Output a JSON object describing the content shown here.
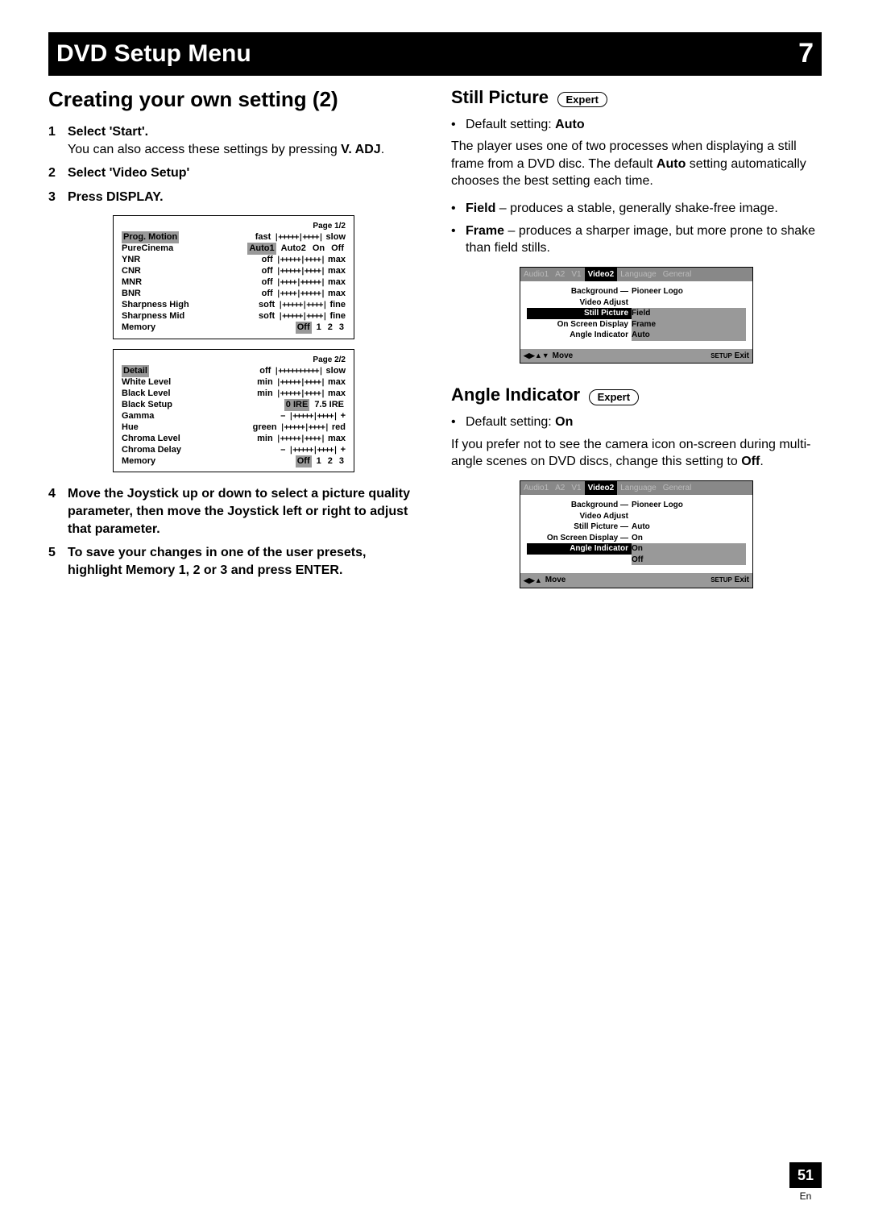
{
  "header": {
    "title": "DVD Setup Menu",
    "chapter": "7"
  },
  "left": {
    "heading": "Creating your own setting (2)",
    "step1": {
      "num": "1",
      "title": "Select 'Start'.",
      "text1": "You can also access these settings by pressing ",
      "bold1": "V. ADJ",
      "text2": "."
    },
    "step2": {
      "num": "2",
      "title": "Select 'Video Setup'"
    },
    "step3": {
      "num": "3",
      "title": "Press DISPLAY."
    },
    "osd1": {
      "page": "Page 1/2",
      "rows": [
        {
          "label": "Prog. Motion",
          "hl": true,
          "left": "fast",
          "slider": "|+++++|++++|",
          "right": "slow"
        },
        {
          "label": "PureCinema",
          "opts": [
            "Auto1",
            "Auto2",
            "On",
            "Off"
          ],
          "sel": 0
        },
        {
          "label": "YNR",
          "left": "off",
          "slider": "|+++++|++++|",
          "right": "max"
        },
        {
          "label": "CNR",
          "left": "off",
          "slider": "|+++++|++++|",
          "right": "max"
        },
        {
          "label": "MNR",
          "left": "off",
          "slider": "|++++|+++++|",
          "right": "max"
        },
        {
          "label": "BNR",
          "left": "off",
          "slider": "|++++|+++++|",
          "right": "max"
        },
        {
          "label": "Sharpness High",
          "left": "soft",
          "slider": "|+++++|++++|",
          "right": "fine"
        },
        {
          "label": "Sharpness Mid",
          "left": "soft",
          "slider": "|+++++|++++|",
          "right": "fine"
        },
        {
          "label": "Memory",
          "opts": [
            "Off",
            "1",
            "2",
            "3"
          ],
          "sel": 0
        }
      ]
    },
    "osd2": {
      "page": "Page 2/2",
      "rows": [
        {
          "label": "Detail",
          "hl": true,
          "left": "off",
          "slider": "|++++++++++|",
          "right": "slow"
        },
        {
          "label": "White Level",
          "left": "min",
          "slider": "|+++++|++++|",
          "right": "max"
        },
        {
          "label": "Black Level",
          "left": "min",
          "slider": "|+++++|++++|",
          "right": "max"
        },
        {
          "label": "Black Setup",
          "opts": [
            "0 IRE",
            "7.5 IRE"
          ],
          "sel": 0
        },
        {
          "label": "Gamma",
          "left": "–",
          "slider": "|+++++|++++|",
          "right": "+"
        },
        {
          "label": "Hue",
          "left": "green",
          "slider": "|+++++|++++|",
          "right": "red"
        },
        {
          "label": "Chroma Level",
          "left": "min",
          "slider": "|+++++|++++|",
          "right": "max"
        },
        {
          "label": "Chroma Delay",
          "left": "–",
          "slider": "|+++++|++++|",
          "right": "+"
        },
        {
          "label": "Memory",
          "opts": [
            "Off",
            "1",
            "2",
            "3"
          ],
          "sel": 0
        }
      ]
    },
    "step4": {
      "num": "4",
      "title": "Move the Joystick up or down to select a picture quality parameter, then move the Joystick left or right to adjust that parameter."
    },
    "step5": {
      "num": "5",
      "title": "To save your changes in one of the user presets, highlight Memory 1, 2 or 3 and press ENTER."
    }
  },
  "right": {
    "still": {
      "heading": "Still Picture",
      "badge": "Expert",
      "default_label": "Default setting: ",
      "default_value": "Auto",
      "para1a": "The player uses one of two processes when displaying a still frame from a DVD disc. The default ",
      "para1b": "Auto",
      "para1c": " setting automatically chooses the best setting each time.",
      "b1a": "Field",
      "b1b": " – produces a stable, generally shake-free image.",
      "b2a": "Frame",
      "b2b": " – produces a sharper image, but more prone to shake than field stills."
    },
    "screen1": {
      "tabs": [
        "Audio1",
        "A2",
        "V1",
        "Video2",
        "Language",
        "General"
      ],
      "active": 3,
      "lines": [
        {
          "key": "Background —",
          "val": "Pioneer Logo"
        },
        {
          "key": "Video Adjust",
          "val": ""
        },
        {
          "key": "Still Picture",
          "val": "Field",
          "hl": true
        },
        {
          "key": "On Screen Display",
          "val": "Frame",
          "shade": true
        },
        {
          "key": "Angle Indicator",
          "val": "Auto",
          "shade": true
        }
      ],
      "move": "Move",
      "setup": "SETUP",
      "exit": "Exit",
      "joy": true
    },
    "angle": {
      "heading": "Angle Indicator",
      "badge": "Expert",
      "default_label": "Default setting: ",
      "default_value": "On",
      "para_a": "If you prefer not to see the camera icon on-screen during multi-angle scenes on DVD discs, change this setting to ",
      "para_b": "Off",
      "para_c": "."
    },
    "screen2": {
      "tabs": [
        "Audio1",
        "A2",
        "V1",
        "Video2",
        "Language",
        "General"
      ],
      "active": 3,
      "lines": [
        {
          "key": "Background —",
          "val": "Pioneer Logo"
        },
        {
          "key": "Video Adjust",
          "val": ""
        },
        {
          "key": "Still Picture —",
          "val": "Auto"
        },
        {
          "key": "On Screen Display —",
          "val": "On"
        },
        {
          "key": "Angle Indicator",
          "val": "On",
          "hl": true
        },
        {
          "key": "",
          "val": "Off",
          "shade": true
        }
      ],
      "move": "Move",
      "setup": "SETUP",
      "exit": "Exit",
      "joy": false
    }
  },
  "footer": {
    "page": "51",
    "lang": "En"
  }
}
